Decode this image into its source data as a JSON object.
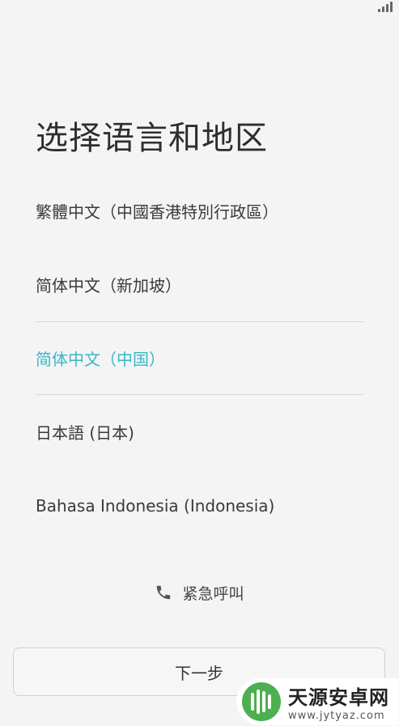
{
  "title": "选择语言和地区",
  "languages": [
    {
      "label": "繁體中文（中國香港特別行政區）",
      "selected": false
    },
    {
      "label": "简体中文（新加坡）",
      "selected": false
    },
    {
      "label": "简体中文（中国）",
      "selected": true
    },
    {
      "label": "日本語 (日本)",
      "selected": false
    },
    {
      "label": "Bahasa Indonesia (Indonesia)",
      "selected": false
    }
  ],
  "emergency": {
    "label": "紧急呼叫",
    "icon": "phone-icon"
  },
  "next_button": {
    "label": "下一步"
  },
  "watermark": {
    "title": "天源安卓网",
    "url": "www.jytyaz.com"
  },
  "colors": {
    "accent": "#3cb5c8",
    "background": "#f4f4f4"
  }
}
